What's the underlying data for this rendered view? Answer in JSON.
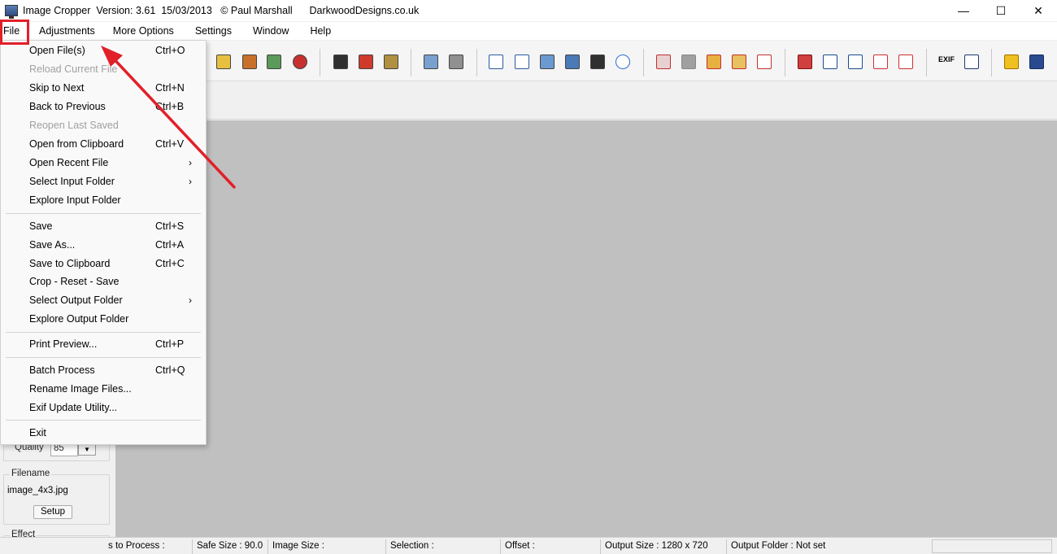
{
  "window": {
    "title": "Image Cropper  Version: 3.61  15/03/2013   © Paul Marshall      DarkwoodDesigns.co.uk",
    "minimize": "—",
    "maximize": "☐",
    "close": "✕"
  },
  "menubar": {
    "items": [
      "File",
      "Adjustments",
      "More Options",
      "Settings",
      "Window",
      "Help"
    ]
  },
  "file_menu": {
    "items": [
      {
        "label": "Open File(s)",
        "shortcut": "Ctrl+O"
      },
      {
        "label": "Reload Current File",
        "shortcut": ""
      },
      {
        "label": "Skip to Next",
        "shortcut": "Ctrl+N"
      },
      {
        "label": "Back to Previous",
        "shortcut": "Ctrl+B"
      },
      {
        "label": "Reopen Last Saved",
        "shortcut": ""
      },
      {
        "label": "Open from Clipboard",
        "shortcut": "Ctrl+V"
      },
      {
        "label": "Open Recent File",
        "shortcut": ""
      },
      {
        "label": "Select Input Folder",
        "shortcut": ""
      },
      {
        "label": "Explore Input Folder",
        "shortcut": ""
      },
      {
        "label": "Save",
        "shortcut": "Ctrl+S"
      },
      {
        "label": "Save As...",
        "shortcut": "Ctrl+A"
      },
      {
        "label": "Save to Clipboard",
        "shortcut": "Ctrl+C"
      },
      {
        "label": "Crop - Reset - Save",
        "shortcut": ""
      },
      {
        "label": "Select Output Folder",
        "shortcut": ""
      },
      {
        "label": "Explore Output Folder",
        "shortcut": ""
      },
      {
        "label": "Print Preview...",
        "shortcut": "Ctrl+P"
      },
      {
        "label": "Batch Process",
        "shortcut": "Ctrl+Q"
      },
      {
        "label": "Rename Image Files...",
        "shortcut": ""
      },
      {
        "label": "Exif Update Utility...",
        "shortcut": ""
      },
      {
        "label": "Exit",
        "shortcut": ""
      }
    ],
    "submenu_arrow": "›"
  },
  "left_panel": {
    "quality_label": "Quality",
    "quality_value": "85",
    "dropdown_arrow": "▼",
    "filename_title": "Filename",
    "filename_value": "image_4x3.jpg",
    "setup_button": "Setup",
    "effect_title": "Effect"
  },
  "statusbar": {
    "files_to_process": "s to Process :",
    "safe_size": "Safe Size : 90.0",
    "image_size": "Image Size :",
    "selection": "Selection :",
    "offset": "Offset :",
    "output_size": "Output Size : 1280 x 720",
    "output_folder": "Output Folder : Not set"
  },
  "toolbar": {
    "icons": [
      "open-icon",
      "open-folder-icon",
      "print-icon",
      "settings-icon",
      "save-icon",
      "save-as-icon",
      "save-all-icon",
      "copy-icon",
      "paste-icon",
      "rotate-left-icon",
      "rotate-right-icon",
      "rotate-free-icon",
      "flip-icon",
      "straighten-icon",
      "undo-icon",
      "crop-back-icon",
      "crop-fill-icon",
      "crop-fit-icon",
      "crop-center-icon",
      "crop-width-icon",
      "preview-icon",
      "grid-icon",
      "grid-fine-icon",
      "frame-icon",
      "hash-grid-icon",
      "exif-icon",
      "info-icon",
      "folder-f-icon",
      "window-icon"
    ],
    "exif_text": "EXIF"
  },
  "colors": {
    "highlight": "#e2202a",
    "canvas": "#c0c0c0"
  }
}
